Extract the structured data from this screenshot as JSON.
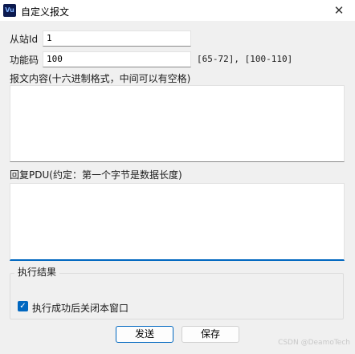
{
  "window": {
    "title": "自定义报文",
    "app_icon_text": "Vu",
    "close_glyph": "✕"
  },
  "form": {
    "slave_id": {
      "label": "从站Id",
      "value": "1"
    },
    "function_code": {
      "label": "功能码",
      "value": "100",
      "hint": "[65-72], [100-110]"
    },
    "message_label": "报文内容(十六进制格式，中间可以有空格)",
    "reply_label": "回复PDU(约定：第一个字节是数据长度)"
  },
  "result": {
    "group_label": "执行结果",
    "close_after_success": {
      "label": "执行成功后关闭本窗口",
      "checked": true
    }
  },
  "buttons": {
    "send": "发送",
    "save": "保存"
  },
  "watermark": "CSDN @DeamoTech"
}
